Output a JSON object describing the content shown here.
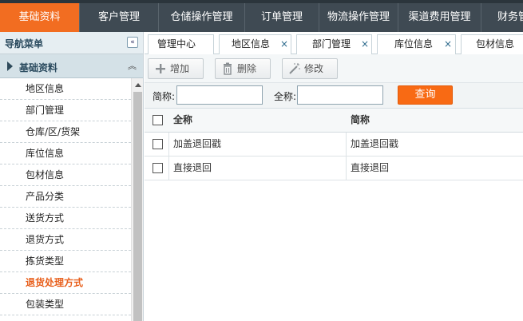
{
  "topnav": {
    "tabs": [
      {
        "label": "基础资料",
        "active": true
      },
      {
        "label": "客户管理",
        "active": false
      },
      {
        "label": "仓储操作管理",
        "active": false
      },
      {
        "label": "订单管理",
        "active": false
      },
      {
        "label": "物流操作管理",
        "active": false
      },
      {
        "label": "渠道费用管理",
        "active": false
      },
      {
        "label": "财务管",
        "active": false
      }
    ],
    "colors": {
      "bar": "#3f4a53",
      "active": "#f26d21"
    }
  },
  "sidebar": {
    "title": "导航菜单",
    "collapse_icon": "double-chevron-left-icon",
    "group": {
      "label": "基础资料",
      "expand_icon": "caret-right-icon",
      "collapse_icon": "double-chevron-up-icon"
    },
    "items": [
      {
        "label": "地区信息",
        "current": false
      },
      {
        "label": "部门管理",
        "current": false
      },
      {
        "label": "仓库/区/货架",
        "current": false
      },
      {
        "label": "库位信息",
        "current": false
      },
      {
        "label": "包材信息",
        "current": false
      },
      {
        "label": "产品分类",
        "current": false
      },
      {
        "label": "送货方式",
        "current": false
      },
      {
        "label": "退货方式",
        "current": false
      },
      {
        "label": "拣货类型",
        "current": false
      },
      {
        "label": "退货处理方式",
        "current": true
      },
      {
        "label": "包装类型",
        "current": false
      }
    ]
  },
  "content_tabs": [
    {
      "label": "管理中心",
      "closable": false
    },
    {
      "label": "地区信息",
      "closable": true
    },
    {
      "label": "部门管理",
      "closable": true
    },
    {
      "label": "库位信息",
      "closable": true
    },
    {
      "label": "包材信息",
      "closable": false
    }
  ],
  "close_glyph": "×",
  "toolbar": {
    "add_label": "增加",
    "delete_label": "删除",
    "edit_label": "修改"
  },
  "search": {
    "short_label": "简称:",
    "short_value": "",
    "full_label": "全称:",
    "full_value": "",
    "button_label": "查询",
    "button_color": "#f86a14"
  },
  "table": {
    "headers": {
      "full": "全称",
      "short": "简称"
    },
    "rows": [
      {
        "full": "加盖退回戳",
        "short": "加盖退回戳"
      },
      {
        "full": "直接退回",
        "short": "直接退回"
      }
    ]
  }
}
